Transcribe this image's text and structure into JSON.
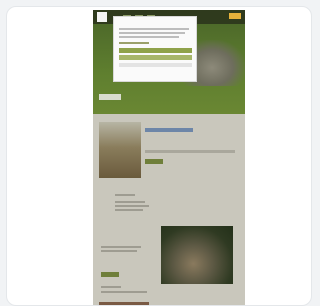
{
  "window": {
    "title": ""
  },
  "site": {
    "logo_text": "",
    "hero": {
      "kicker": "",
      "title": "",
      "button": ""
    },
    "section1": {
      "tag": "",
      "title": "",
      "button": ""
    },
    "section2": {
      "kicker": "",
      "title": "",
      "button": ""
    }
  },
  "cookie_modal": {
    "title": "",
    "accept_label": "",
    "settings_label": "",
    "footer_left": "",
    "footer_right": ""
  }
}
